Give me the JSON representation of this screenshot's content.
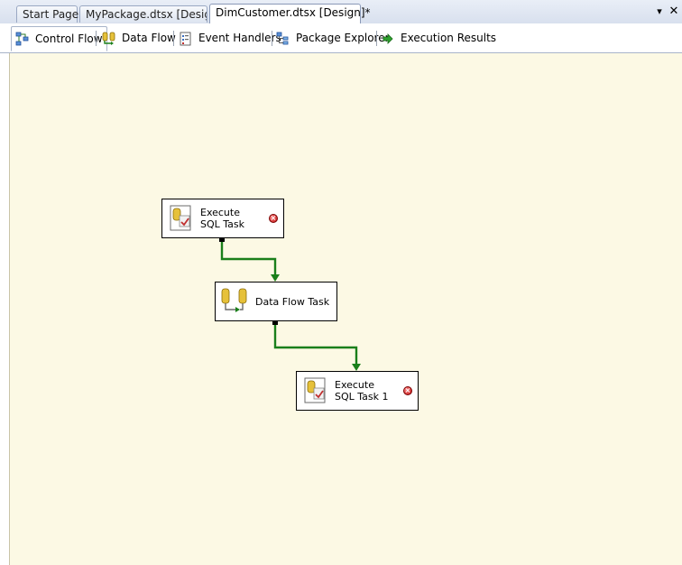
{
  "doc_tabs": [
    {
      "label": "Start Page"
    },
    {
      "label": "MyPackage.dtsx [Design]"
    },
    {
      "label": "DimCustomer.dtsx [Design]*"
    }
  ],
  "doc_tab_controls": {
    "menu": "▾",
    "close": "✕"
  },
  "designer_tabs": [
    {
      "label": "Control Flow",
      "icon": "control-flow-icon",
      "active": true
    },
    {
      "label": "Data Flow",
      "icon": "data-flow-icon"
    },
    {
      "label": "Event Handlers",
      "icon": "event-handlers-icon"
    },
    {
      "label": "Package Explorer",
      "icon": "package-explorer-icon"
    },
    {
      "label": "Execution Results",
      "icon": "execution-results-icon"
    }
  ],
  "tasks": [
    {
      "line1": "Execute",
      "line2": "SQL Task",
      "icon": "execute-sql-task-icon",
      "error": true
    },
    {
      "line1": "Data Flow Task",
      "icon": "data-flow-task-icon",
      "error": false
    },
    {
      "line1": "Execute",
      "line2": "SQL Task 1",
      "icon": "execute-sql-task-icon",
      "error": true
    }
  ],
  "colors": {
    "canvas": "#fcf9e4",
    "precedence_success": "#1a7f1a",
    "error": "#c01010"
  }
}
